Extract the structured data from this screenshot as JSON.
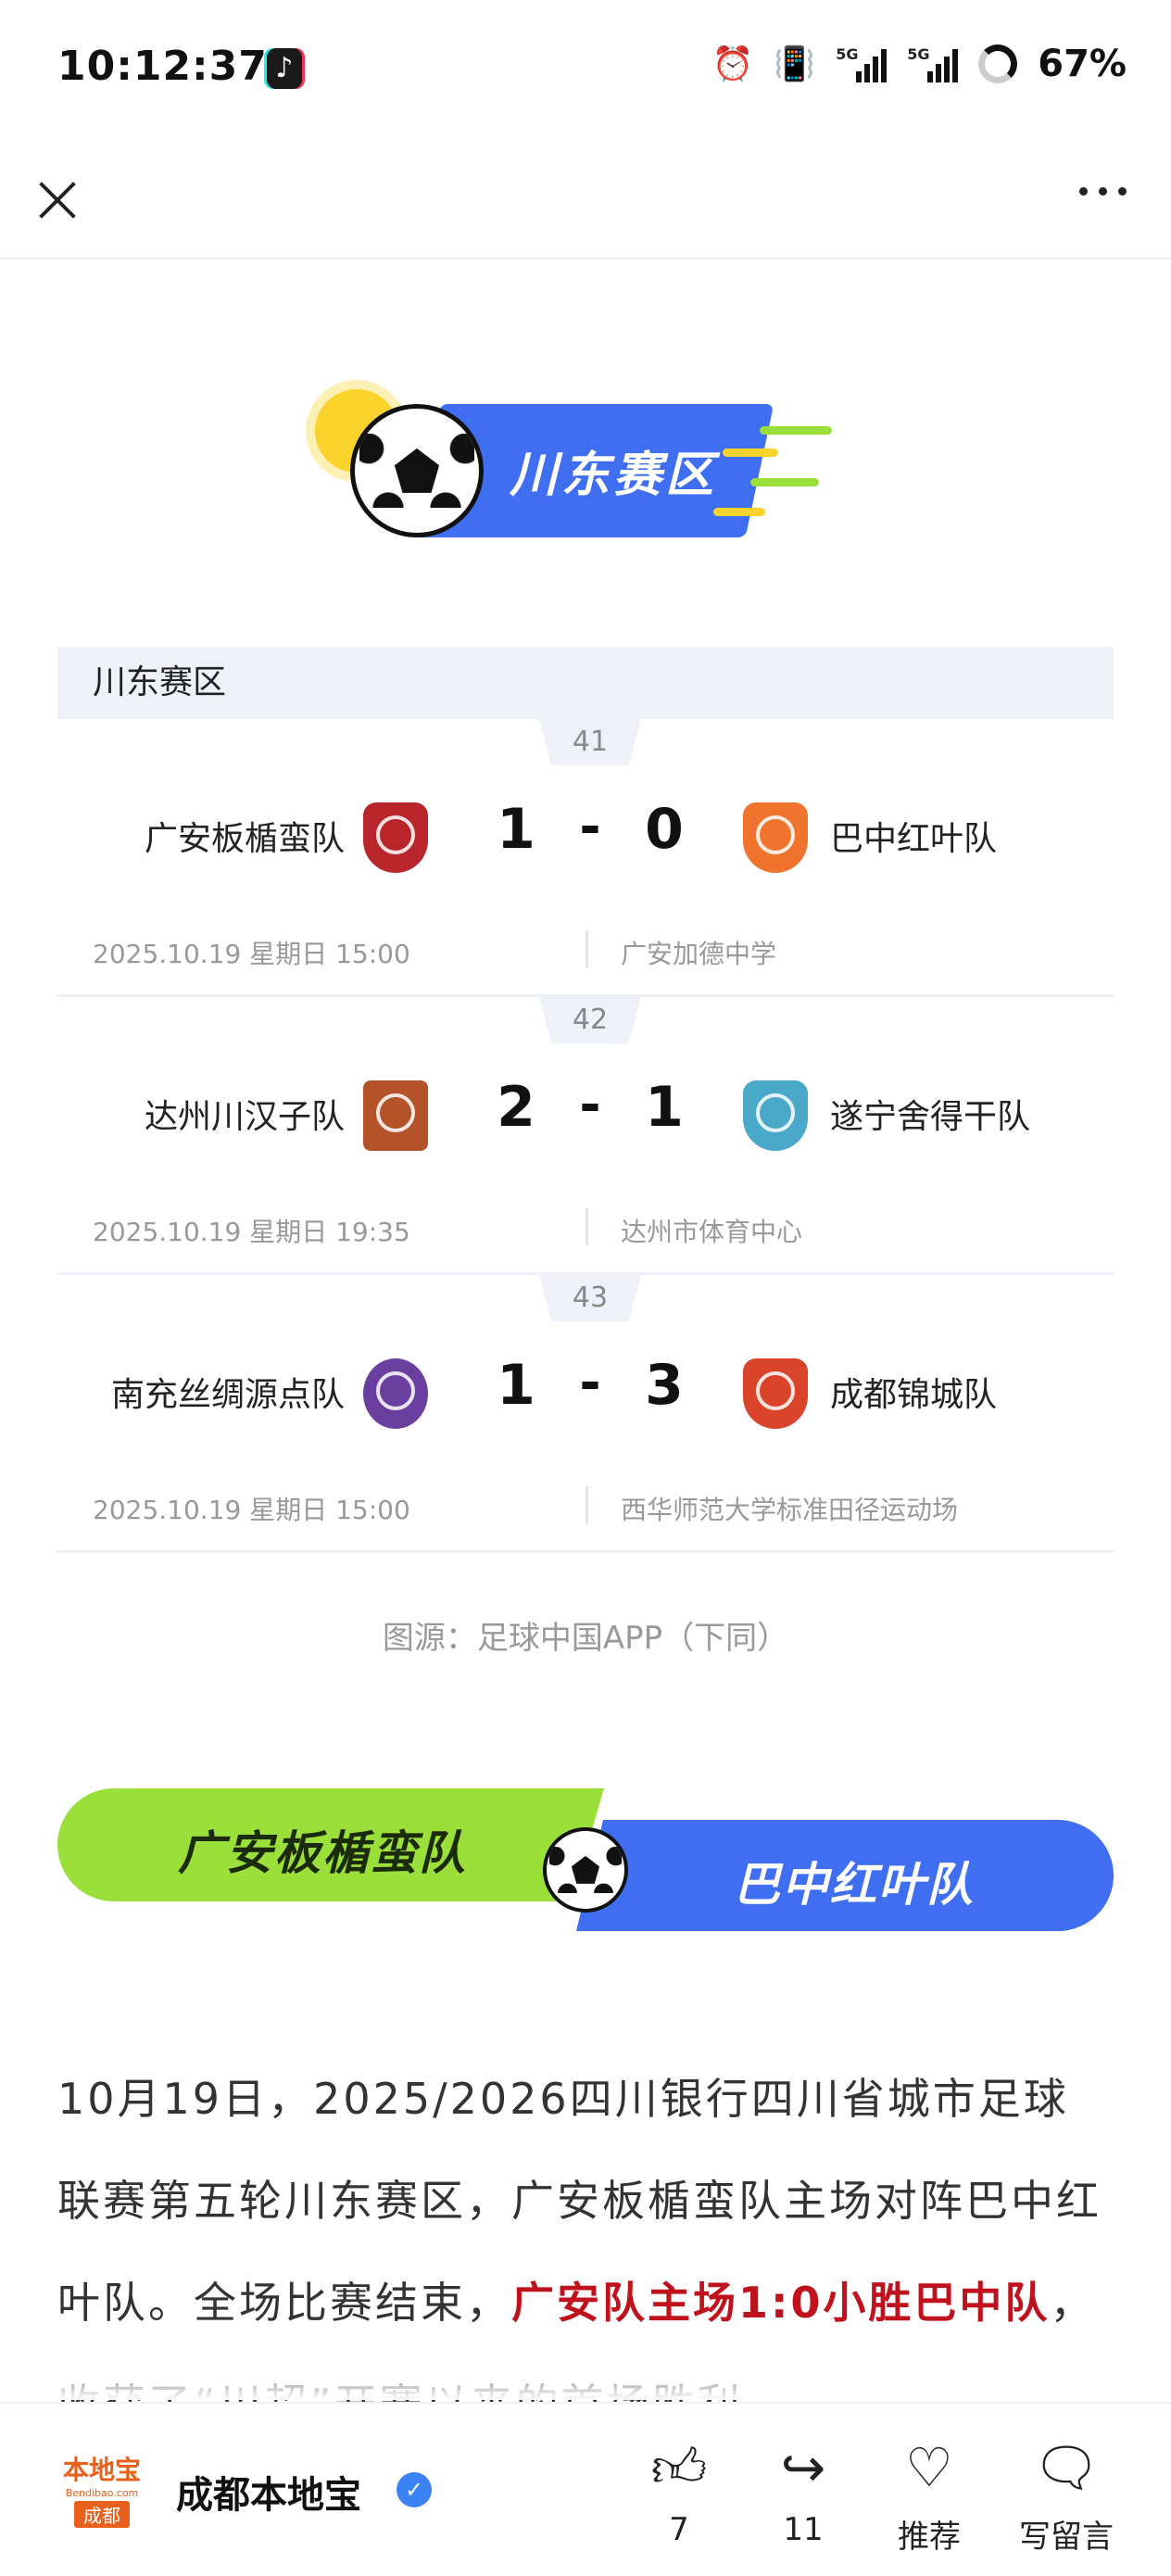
{
  "status_bar": {
    "time": "10:12:37",
    "app_icon": "tiktok-icon",
    "network_1": "5G",
    "network_2": "5G",
    "battery": "67%"
  },
  "header": {
    "close_icon": "close-icon",
    "more_icon": "more-icon"
  },
  "region_banner": {
    "title": "川东赛区"
  },
  "table": {
    "title": "川东赛区",
    "matches": [
      {
        "no": "41",
        "home": "广安板楯蛮队",
        "home_score": "1",
        "dash": "-",
        "away_score": "0",
        "away": "巴中红叶队",
        "date": "2025.10.19 星期日 15:00",
        "venue": "广安加德中学",
        "home_color": "#b8262c",
        "away_color": "#f0742e"
      },
      {
        "no": "42",
        "home": "达州川汉子队",
        "home_score": "2",
        "dash": "-",
        "away_score": "1",
        "away": "遂宁舍得干队",
        "date": "2025.10.19 星期日 19:35",
        "venue": "达州市体育中心",
        "home_color": "#b4522a",
        "away_color": "#4aa9c8"
      },
      {
        "no": "43",
        "home": "南充丝绸源点队",
        "home_score": "1",
        "dash": "-",
        "away_score": "3",
        "away": "成都锦城队",
        "date": "2025.10.19 星期日 15:00",
        "venue": "西华师范大学标准田径运动场",
        "home_color": "#6b3fa0",
        "away_color": "#d9442a"
      }
    ]
  },
  "source_note": "图源：足球中国APP（下同）",
  "matchup": {
    "left": "广安板楯蛮队",
    "right": "巴中红叶队"
  },
  "article": {
    "p1_before": "10月19日，2025/2026四川银行四川省城市足球联赛第五轮川东赛区，广安板楯蛮队主场对阵巴中红叶队。全场比赛结束，",
    "p1_highlight": "广安队主场1:0小胜巴中队",
    "p1_after": "，收获了“川超”开赛以来的首场胜利。"
  },
  "bottom_bar": {
    "logo_top": "本地宝",
    "logo_mid": "Bendibao.com",
    "logo_city": "成都",
    "account_name": "成都本地宝",
    "verified_icon": "verified-icon",
    "like_count": "7",
    "share_count": "11",
    "recommend_label": "推荐",
    "comment_label": "写留言"
  },
  "colors": {
    "blue": "#3f6ef0",
    "green": "#9be03a",
    "highlight_red": "#c0121c"
  }
}
